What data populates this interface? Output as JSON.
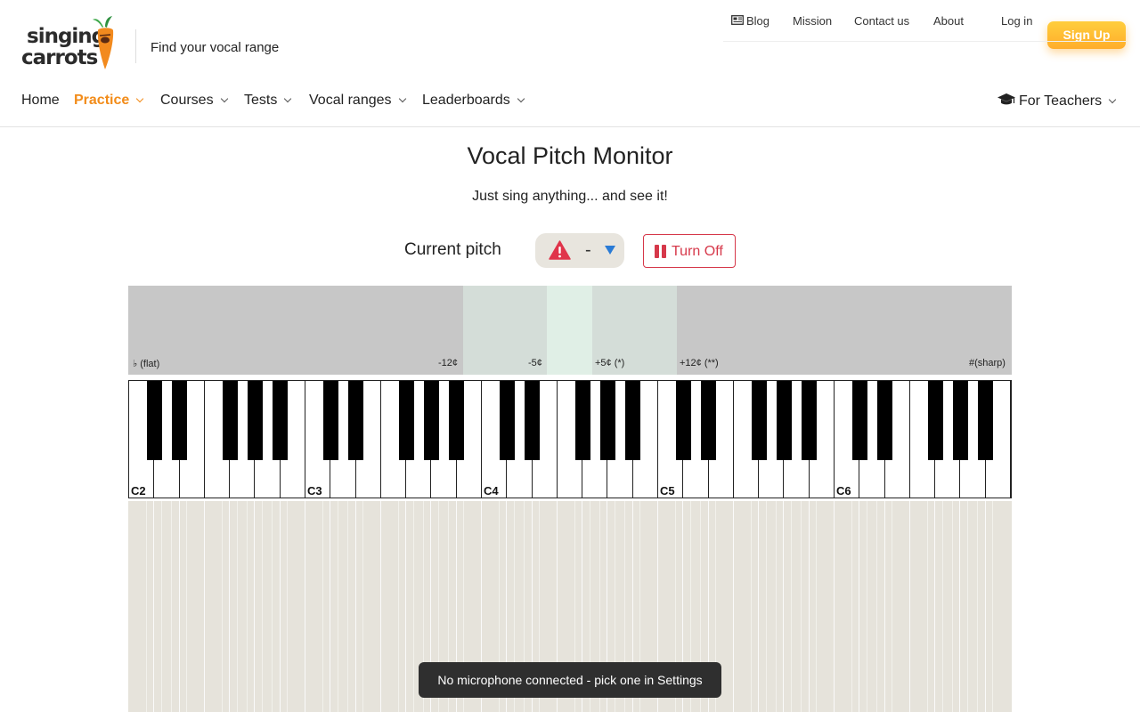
{
  "brand": {
    "line1": "singing",
    "line2": "carrots",
    "tagline": "Find your vocal range"
  },
  "topnav": {
    "blog": "Blog",
    "mission": "Mission",
    "contact": "Contact us",
    "about": "About",
    "login": "Log in",
    "signup": "Sign Up"
  },
  "mainnav": {
    "items": [
      {
        "label": "Home",
        "dropdown": false,
        "active": false
      },
      {
        "label": "Practice",
        "dropdown": true,
        "active": true
      },
      {
        "label": "Courses",
        "dropdown": true,
        "active": false
      },
      {
        "label": "Tests",
        "dropdown": true,
        "active": false
      },
      {
        "label": "Vocal ranges",
        "dropdown": true,
        "active": false
      },
      {
        "label": "Leaderboards",
        "dropdown": true,
        "active": false
      }
    ],
    "teachers": "For Teachers"
  },
  "page": {
    "title": "Vocal Pitch Monitor",
    "subtitle": "Just sing anything... and see it!"
  },
  "pitch": {
    "label": "Current pitch",
    "value": "-",
    "turn_off": "Turn Off"
  },
  "tuner": {
    "flat": "♭ (flat)",
    "minus12": "-12¢",
    "minus5": "-5¢",
    "plus5": "+5¢ (*)",
    "plus12": "+12¢ (**)",
    "sharp": "#(sharp)"
  },
  "piano": {
    "octaves": [
      "C2",
      "C3",
      "C4",
      "C5",
      "C6"
    ]
  },
  "toast": {
    "message": "No microphone connected - pick one in Settings"
  },
  "colors": {
    "accent": "#f28c1a",
    "signup": "#ffb52e",
    "danger": "#d6384a",
    "caret": "#2a7bd6",
    "tuner_bg": "#c7c7c7",
    "tuner_near": "#d4ddd8",
    "tuner_center": "#e0efe6",
    "lane_bg": "#e6e3db"
  }
}
